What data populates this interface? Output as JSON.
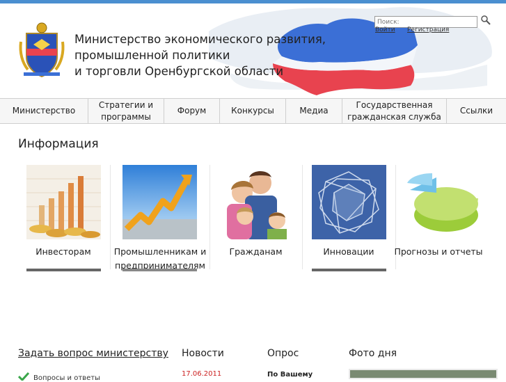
{
  "header": {
    "title_lines": [
      "Министерство экономического развития,",
      "промышленной политики",
      "и торговли Оренбургской области"
    ],
    "search_placeholder": "Поиск:",
    "login_link": "Войти",
    "register_link": "Регистрация"
  },
  "nav": {
    "items": [
      "Министерство",
      "Стратегии и программы",
      "Форум",
      "Конкурсы",
      "Медиа",
      "Государственная гражданская служба",
      "Ссылки"
    ]
  },
  "info": {
    "title": "Информация",
    "tiles": [
      {
        "label": "Инвесторам",
        "icon": "coins-chart-icon"
      },
      {
        "label": "Промышленникам и предпринимателям",
        "icon": "growth-arrow-icon"
      },
      {
        "label": "Гражданам",
        "icon": "family-photo-icon"
      },
      {
        "label": "Инновации",
        "icon": "innovation-shape-icon"
      },
      {
        "label": "Прогнозы и отчеты",
        "icon": "pie-chart-icon"
      }
    ]
  },
  "bottom": {
    "ask_link": "Задать вопрос министерству",
    "qa_link": "Вопросы и ответы",
    "news_title": "Новости",
    "news_date": "17.06.2011",
    "poll_title": "Опрос",
    "poll_question": "По Вашему",
    "photo_title": "Фото дня"
  },
  "colors": {
    "accent_blue": "#4a8fd0",
    "map_red": "#e8434f",
    "map_blue": "#3b6fd6",
    "date_red": "#cc2222"
  }
}
